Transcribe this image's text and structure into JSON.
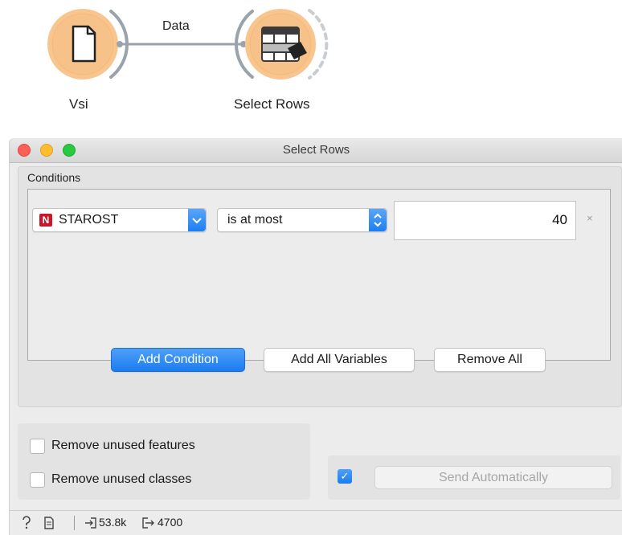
{
  "workflow": {
    "link_label": "Data",
    "nodes": [
      {
        "label": "Vsi",
        "icon": "file-icon"
      },
      {
        "label": "Select Rows",
        "icon": "select-rows-icon"
      }
    ],
    "node_color": "#f9c58f"
  },
  "window": {
    "title": "Select Rows",
    "conditions_label": "Conditions",
    "condition": {
      "variable_type_badge": "N",
      "variable": "STAROST",
      "operator": "is at most",
      "value": "40",
      "remove_symbol": "×"
    },
    "buttons": {
      "add_condition": "Add Condition",
      "add_all_variables": "Add All Variables",
      "remove_all": "Remove All"
    },
    "options": {
      "remove_unused_features": "Remove unused features",
      "remove_unused_classes": "Remove unused classes"
    },
    "commit": {
      "checked_symbol": "✓",
      "send_label": "Send Automatically"
    },
    "status": {
      "input_count": "53.8k",
      "output_count": "4700"
    },
    "colors": {
      "accent": "#1b7cf0",
      "badge": "#c8162a"
    }
  }
}
